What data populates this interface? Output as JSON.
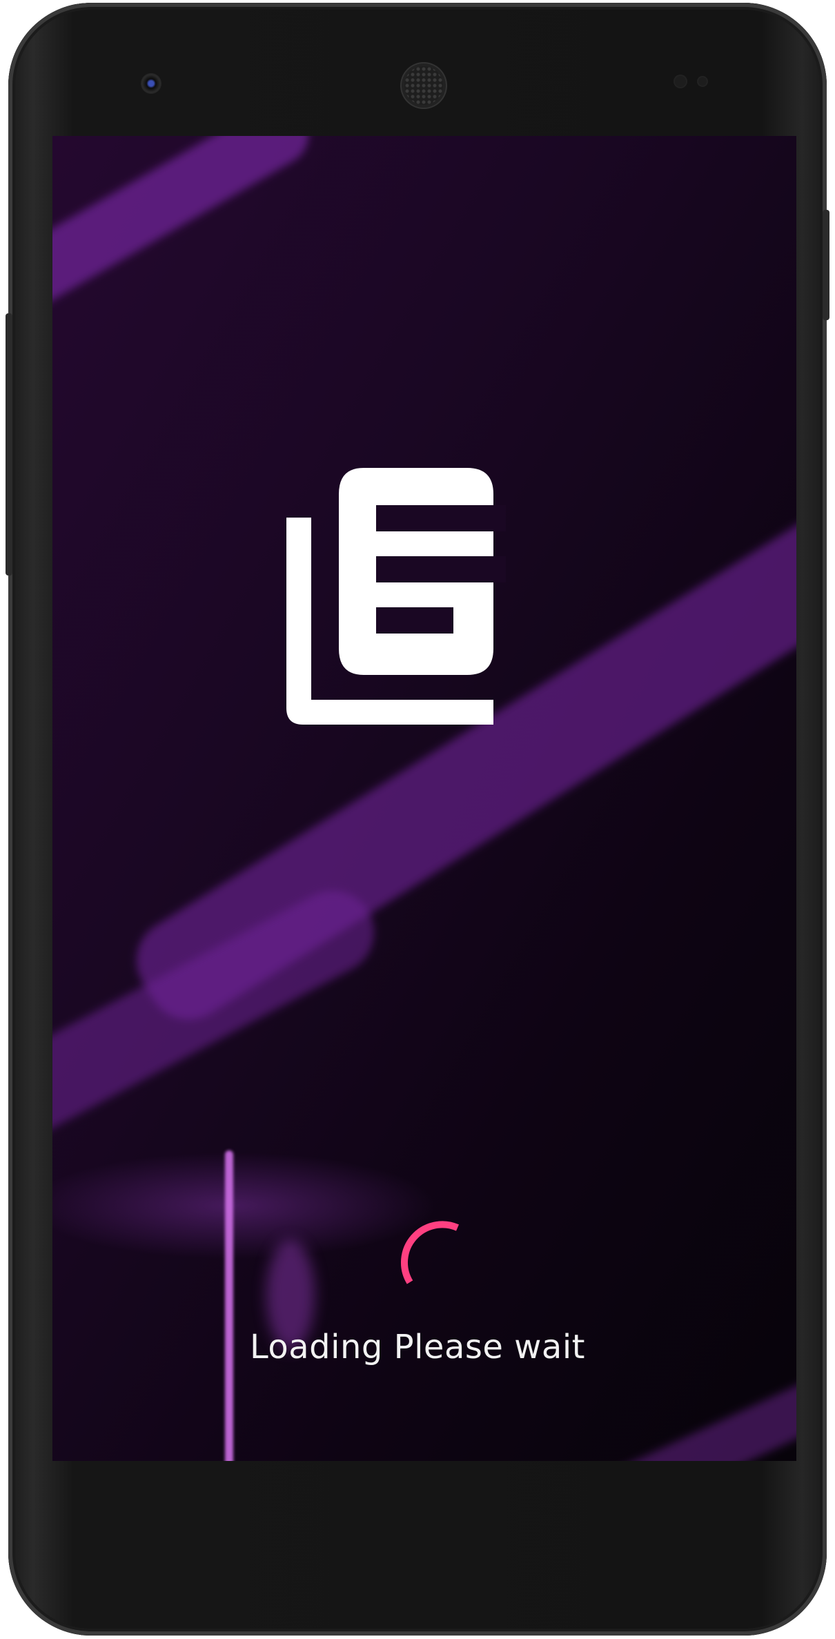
{
  "device": {
    "model_hint": "android-phone-frame"
  },
  "splash": {
    "logo_icon": "library-books-icon",
    "spinner_icon": "progress-spinner-icon",
    "loading_text": "Loading Please wait"
  },
  "colors": {
    "background_dark": "#0e0413",
    "background_purple": "#6b1f8a",
    "logo": "#ffffff",
    "spinner_accent": "#ff4081",
    "text": "#f2f2f2"
  }
}
